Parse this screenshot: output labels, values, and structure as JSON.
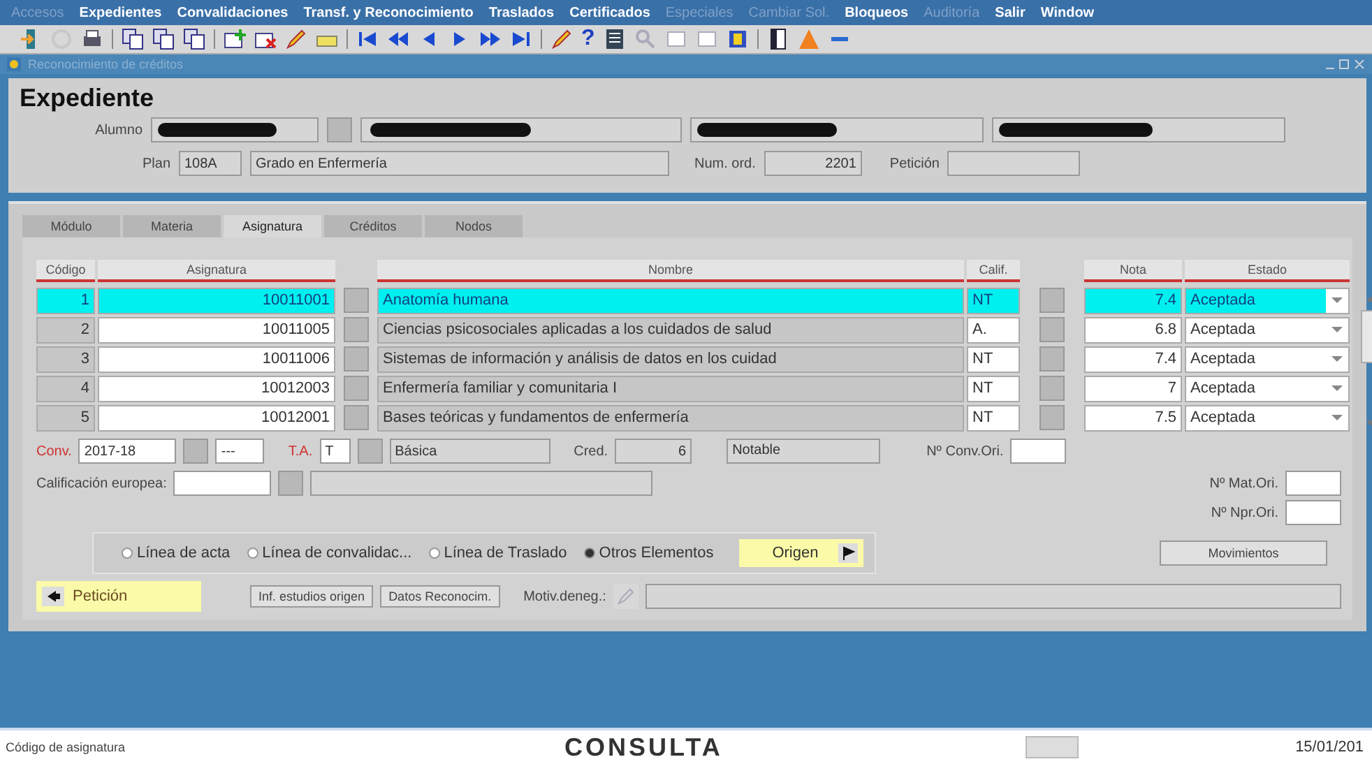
{
  "menu": [
    {
      "label": "Accesos",
      "disabled": true
    },
    {
      "label": "Expedientes",
      "disabled": false
    },
    {
      "label": "Convalidaciones",
      "disabled": false
    },
    {
      "label": "Transf. y Reconocimiento",
      "disabled": false
    },
    {
      "label": "Traslados",
      "disabled": false
    },
    {
      "label": "Certificados",
      "disabled": false
    },
    {
      "label": "Especiales",
      "disabled": true
    },
    {
      "label": "Cambiar Sol.",
      "disabled": true
    },
    {
      "label": "Bloqueos",
      "disabled": false
    },
    {
      "label": "Auditoría",
      "disabled": true
    },
    {
      "label": "Salir",
      "disabled": false
    },
    {
      "label": "Window",
      "disabled": false
    }
  ],
  "toolbar": {
    "help_glyph": "?"
  },
  "window": {
    "title": "Reconocimiento de créditos"
  },
  "header": {
    "title": "Expediente",
    "alumno_label": "Alumno",
    "plan_label": "Plan",
    "plan_code": "108A",
    "plan_name": "Grado en Enfermería",
    "num_ord_label": "Num. ord.",
    "num_ord": "2201",
    "peticion_label": "Petición"
  },
  "tabs": [
    {
      "label": "Módulo",
      "selected": false
    },
    {
      "label": "Materia",
      "selected": false
    },
    {
      "label": "Asignatura",
      "selected": true
    },
    {
      "label": "Créditos",
      "selected": false
    },
    {
      "label": "Nodos",
      "selected": false
    }
  ],
  "table": {
    "columns": [
      "Código",
      "Asignatura",
      "Nombre",
      "Calif.",
      "Nota",
      "Estado"
    ],
    "rows": [
      {
        "codigo": "1",
        "asignatura": "10011001",
        "nombre": "Anatomía humana",
        "calif": "NT",
        "nota": "7.4",
        "estado": "Aceptada",
        "selected": true
      },
      {
        "codigo": "2",
        "asignatura": "10011005",
        "nombre": "Ciencias psicosociales aplicadas a los cuidados de salud",
        "calif": "A.",
        "nota": "6.8",
        "estado": "Aceptada",
        "selected": false
      },
      {
        "codigo": "3",
        "asignatura": "10011006",
        "nombre": "Sistemas de información y análisis de datos en los cuidad",
        "calif": "NT",
        "nota": "7.4",
        "estado": "Aceptada",
        "selected": false
      },
      {
        "codigo": "4",
        "asignatura": "10012003",
        "nombre": "Enfermería familiar y comunitaria I",
        "calif": "NT",
        "nota": "7",
        "estado": "Aceptada",
        "selected": false
      },
      {
        "codigo": "5",
        "asignatura": "10012001",
        "nombre": "Bases teóricas y fundamentos de enfermería",
        "calif": "NT",
        "nota": "7.5",
        "estado": "Aceptada",
        "selected": false
      }
    ]
  },
  "detail": {
    "conv_label": "Conv.",
    "conv": "2017-18",
    "conv_extra": "---",
    "ta_label": "T.A.",
    "ta": "T",
    "ta_name": "Básica",
    "cred_label": "Cred.",
    "cred": "6",
    "calif_text": "Notable",
    "conv_ori_label": "Nº Conv.Ori.",
    "mat_ori_label": "Nº Mat.Ori.",
    "npr_ori_label": "Nº Npr.Ori.",
    "europea_label": "Calificación europea:"
  },
  "radios": [
    {
      "label": "Línea de acta",
      "selected": false
    },
    {
      "label": "Línea de convalidac...",
      "selected": false
    },
    {
      "label": "Línea de Traslado",
      "selected": false
    },
    {
      "label": "Otros Elementos",
      "selected": true
    }
  ],
  "buttons": {
    "origen": "Origen",
    "movimientos": "Movimientos",
    "peticion": "Petición",
    "inf": "Inf. estudios origen",
    "datos": "Datos Reconocim.",
    "motiv_label": "Motiv.deneg.:"
  },
  "status_bar": {
    "hint": "Código de asignatura",
    "mode": "CONSULTA",
    "date": "15/01/201"
  }
}
